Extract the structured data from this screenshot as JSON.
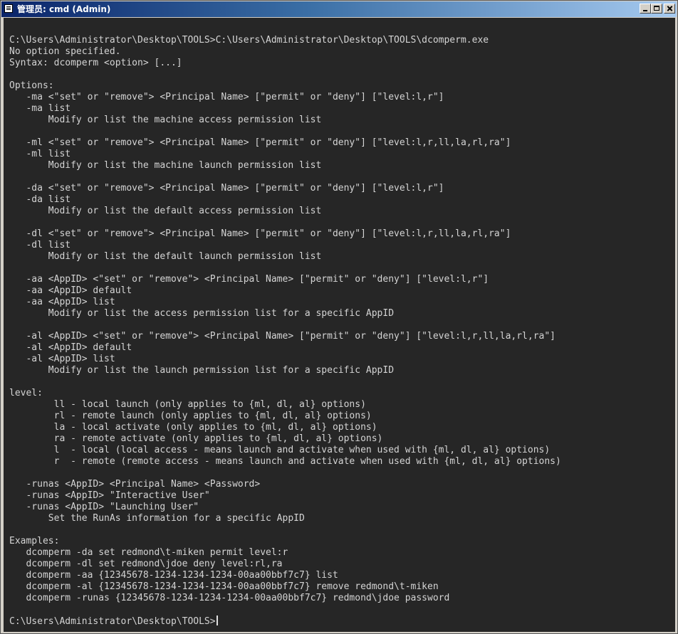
{
  "window": {
    "title": "管理员: cmd (Admin)"
  },
  "console": {
    "lines": [
      "C:\\Users\\Administrator\\Desktop\\TOOLS>C:\\Users\\Administrator\\Desktop\\TOOLS\\dcomperm.exe",
      "No option specified.",
      "Syntax: dcomperm <option> [...]",
      "",
      "Options:",
      "   -ma <\"set\" or \"remove\"> <Principal Name> [\"permit\" or \"deny\"] [\"level:l,r\"]",
      "   -ma list",
      "       Modify or list the machine access permission list",
      "",
      "   -ml <\"set\" or \"remove\"> <Principal Name> [\"permit\" or \"deny\"] [\"level:l,r,ll,la,rl,ra\"]",
      "   -ml list",
      "       Modify or list the machine launch permission list",
      "",
      "   -da <\"set\" or \"remove\"> <Principal Name> [\"permit\" or \"deny\"] [\"level:l,r\"]",
      "   -da list",
      "       Modify or list the default access permission list",
      "",
      "   -dl <\"set\" or \"remove\"> <Principal Name> [\"permit\" or \"deny\"] [\"level:l,r,ll,la,rl,ra\"]",
      "   -dl list",
      "       Modify or list the default launch permission list",
      "",
      "   -aa <AppID> <\"set\" or \"remove\"> <Principal Name> [\"permit\" or \"deny\"] [\"level:l,r\"]",
      "   -aa <AppID> default",
      "   -aa <AppID> list",
      "       Modify or list the access permission list for a specific AppID",
      "",
      "   -al <AppID> <\"set\" or \"remove\"> <Principal Name> [\"permit\" or \"deny\"] [\"level:l,r,ll,la,rl,ra\"]",
      "   -al <AppID> default",
      "   -al <AppID> list",
      "       Modify or list the launch permission list for a specific AppID",
      "",
      "level:",
      "        ll - local launch (only applies to {ml, dl, al} options)",
      "        rl - remote launch (only applies to {ml, dl, al} options)",
      "        la - local activate (only applies to {ml, dl, al} options)",
      "        ra - remote activate (only applies to {ml, dl, al} options)",
      "        l  - local (local access - means launch and activate when used with {ml, dl, al} options)",
      "        r  - remote (remote access - means launch and activate when used with {ml, dl, al} options)",
      "",
      "   -runas <AppID> <Principal Name> <Password>",
      "   -runas <AppID> \"Interactive User\"",
      "   -runas <AppID> \"Launching User\"",
      "       Set the RunAs information for a specific AppID",
      "",
      "Examples:",
      "   dcomperm -da set redmond\\t-miken permit level:r",
      "   dcomperm -dl set redmond\\jdoe deny level:rl,ra",
      "   dcomperm -aa {12345678-1234-1234-1234-00aa00bbf7c7} list",
      "   dcomperm -al {12345678-1234-1234-1234-00aa00bbf7c7} remove redmond\\t-miken",
      "   dcomperm -runas {12345678-1234-1234-1234-00aa00bbf7c7} redmond\\jdoe password",
      ""
    ],
    "prompt": "C:\\Users\\Administrator\\Desktop\\TOOLS>"
  }
}
